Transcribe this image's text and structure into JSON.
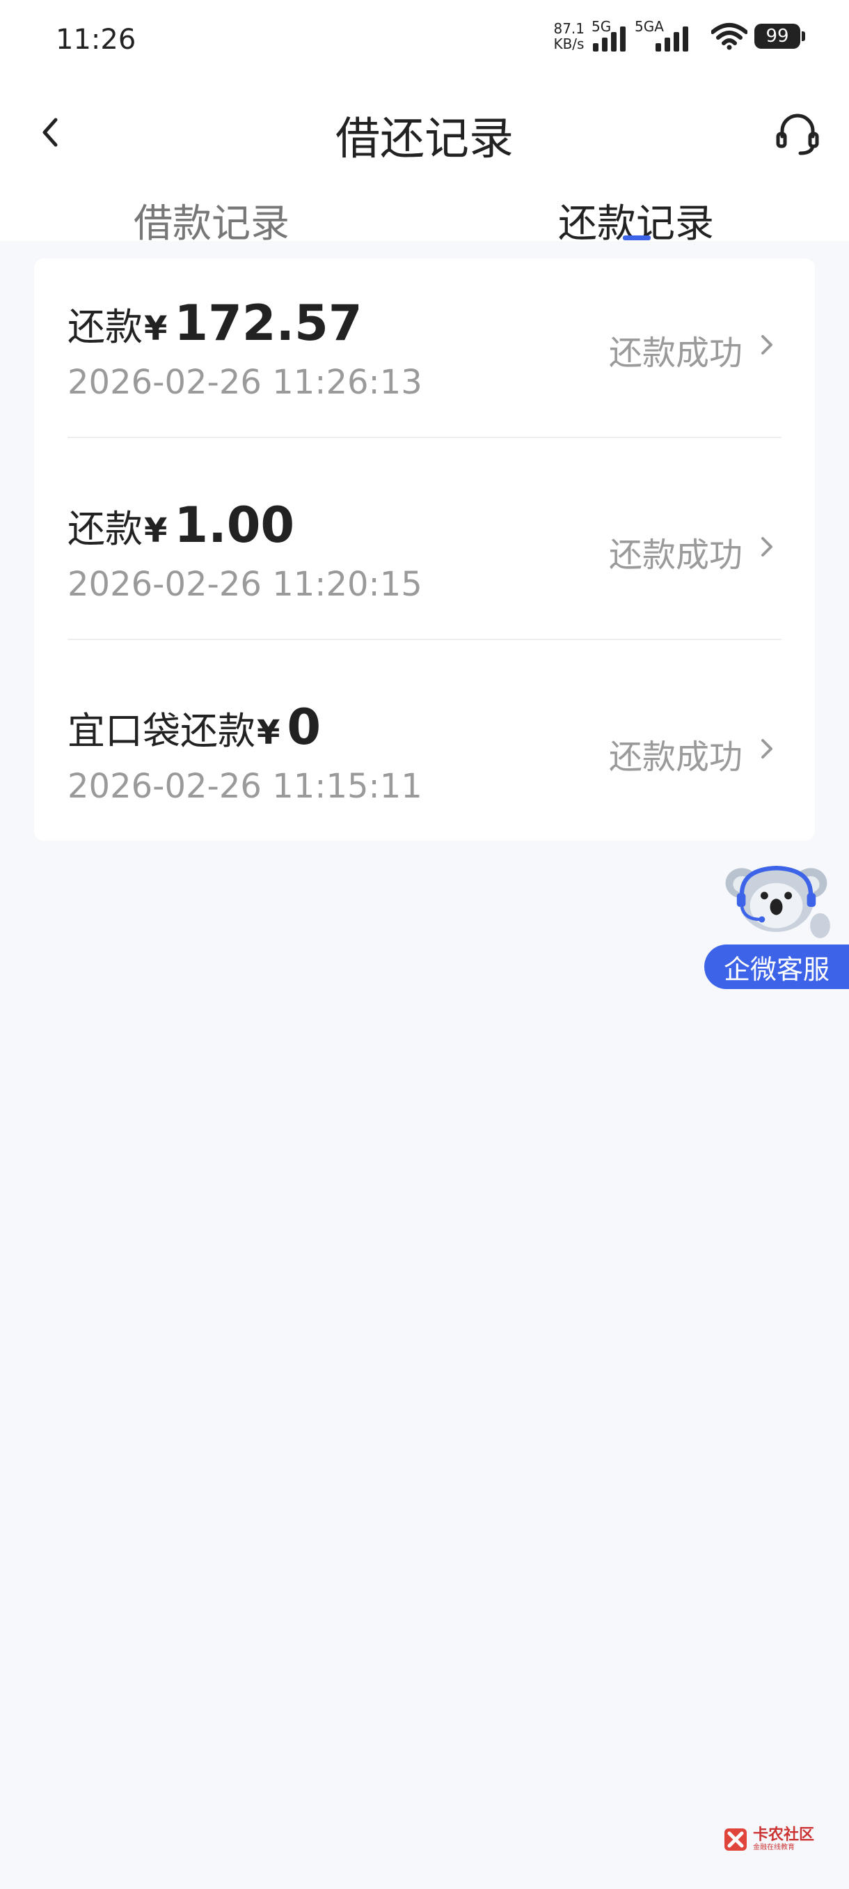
{
  "status_bar": {
    "time": "11:26",
    "net_speed_value": "87.1",
    "net_speed_unit": "KB/s",
    "sim1_label": "5G",
    "sim2_label": "5GA",
    "battery": "99"
  },
  "header": {
    "title": "借还记录",
    "back_icon": "chevron-left-icon",
    "service_icon": "headset-icon"
  },
  "tabs": [
    {
      "label": "借款记录",
      "active": false
    },
    {
      "label": "还款记录",
      "active": true
    }
  ],
  "records": [
    {
      "label": "还款",
      "currency": "¥",
      "amount": "172.57",
      "time": "2026-02-26 11:26:13",
      "status": "还款成功"
    },
    {
      "label": "还款",
      "currency": "¥",
      "amount": "1.00",
      "time": "2026-02-26 11:20:15",
      "status": "还款成功"
    },
    {
      "label": "宜口袋还款",
      "currency": "¥",
      "amount": "0",
      "time": "2026-02-26 11:15:11",
      "status": "还款成功"
    }
  ],
  "float_service": {
    "label": "企微客服",
    "icon": "koala-mascot-icon"
  },
  "watermark": {
    "main": "卡农社区",
    "sub": "金融在线教育"
  },
  "colors": {
    "accent": "#3c63e8",
    "background": "#f7f8fc",
    "muted_text": "#9a9a9a"
  }
}
